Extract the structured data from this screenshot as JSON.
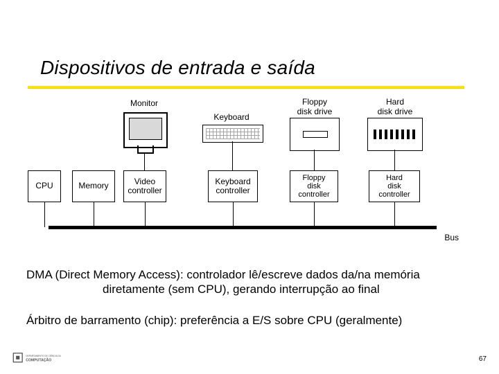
{
  "title": "Dispositivos de entrada e saída",
  "diagram": {
    "devices": {
      "monitor": "Monitor",
      "keyboard": "Keyboard",
      "floppy": "Floppy\ndisk drive",
      "hdd": "Hard\ndisk drive"
    },
    "controllers": {
      "cpu": "CPU",
      "memory": "Memory",
      "video": "Video\ncontroller",
      "keyboard": "Keyboard\ncontroller",
      "floppy": "Floppy\ndisk\ncontroller",
      "hdd": "Hard\ndisk\ncontroller"
    },
    "bus_label": "Bus"
  },
  "paragraphs": {
    "dma_line1": "DMA (Direct Memory Access): controlador lê/escreve dados da/na memória",
    "dma_line2": "diretamente (sem CPU), gerando interrupção ao final",
    "arbiter": "Árbitro de barramento (chip): preferência a E/S sobre CPU (geralmente)"
  },
  "page_number": "67",
  "footer_logo_text": "DEPARTAMENTO DE CIÊNCIA DA COMPUTAÇÃO"
}
